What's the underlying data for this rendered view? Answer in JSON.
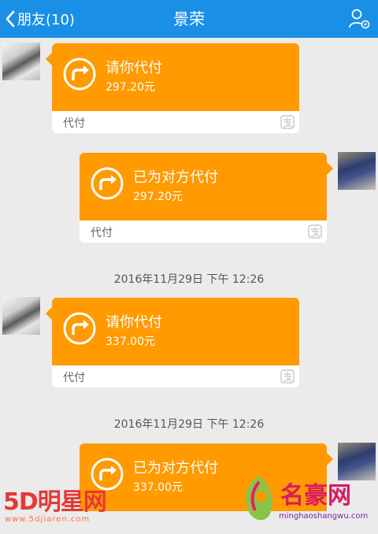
{
  "navbar": {
    "back_label": "朋友(10)",
    "title": "景荣"
  },
  "messages": [
    {
      "direction": "incoming",
      "title": "请你代付",
      "amount": "297.20元",
      "source": "代付"
    },
    {
      "direction": "outgoing",
      "title": "已为对方代付",
      "amount": "297.20元",
      "source": "代付"
    },
    {
      "direction": "incoming",
      "title": "请你代付",
      "amount": "337.00元",
      "source": "代付"
    },
    {
      "direction": "outgoing",
      "title": "已为对方代付",
      "amount": "337.00元",
      "source": "代付"
    }
  ],
  "timestamps": [
    "2016年11月29日 下午 12:26",
    "2016年11月29日 下午 12:26"
  ],
  "watermarks": {
    "left_main": "5D明星网",
    "left_sub": "www.5djiaren.com",
    "right_main": "名豪网",
    "right_sub": "minghaoshangwu.com"
  },
  "colors": {
    "navbar": "#1a8fe6",
    "bubble": "#ff9a00",
    "background": "#ebebeb"
  },
  "icons": [
    "chevron-left-icon",
    "contact-settings-icon",
    "share-arrow-icon",
    "alipay-icon"
  ]
}
